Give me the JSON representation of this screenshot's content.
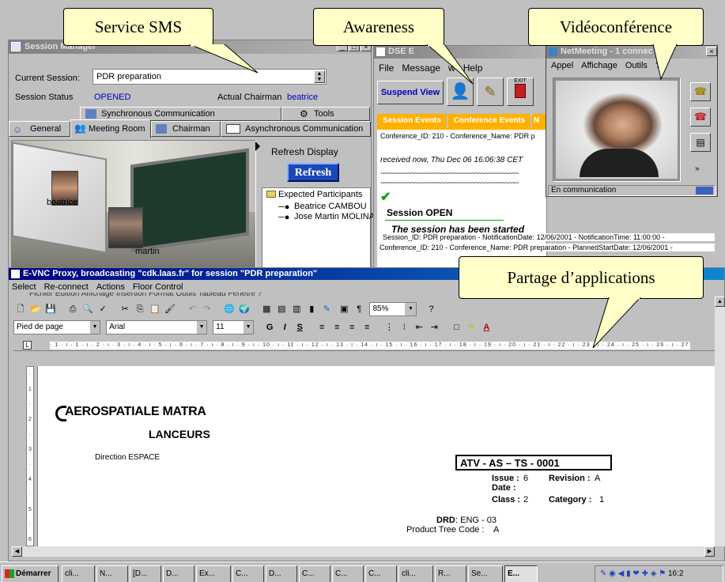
{
  "callouts": {
    "sms": "Service SMS",
    "awareness": "Awareness",
    "video": "Vidéoconférence",
    "sharing": "Partage d’applications"
  },
  "session_manager": {
    "title": "Session Manager",
    "current_session_label": "Current Session:",
    "current_session_value": "PDR preparation",
    "status_label": "Session Status",
    "status_value": "OPENED",
    "chairman_label": "Actual Chairman",
    "chairman_value": "beatrice",
    "tabs_row1": [
      "Synchronous Communication",
      "Tools"
    ],
    "tabs_row2": [
      "General",
      "Meeting Room",
      "Chairman",
      "Asynchronous Communication"
    ],
    "refresh_display_label": "Refresh Display",
    "refresh_button": "Refresh",
    "participants_header": "Expected Participants",
    "participants": [
      "Beatrice CAMBOU",
      "Jose Martin MOLINA"
    ],
    "avatars": [
      "beatrice",
      "martin"
    ]
  },
  "dse_window": {
    "title": "DSE E",
    "menu": [
      "File",
      "Message",
      "w",
      "Help"
    ],
    "suspend_view": "Suspend View",
    "exit_label": "EXIT",
    "tabs": [
      "Session Events",
      "Conference Events",
      "N"
    ],
    "lines": [
      "Conference_ID: 210 - Conference_Name: PDR p",
      "received now, Thu Dec 06 16:06:38 CET",
      "~~~~~~~~~~~~~~~~~~~~~~~~~~~~~~~~~~~~~~~~~",
      "~~~~~~~~~~~~~~~~~~~~~~~~~~~~~~~~~~~~~~~~~"
    ],
    "event_title": "Session OPEN",
    "event_subtitle": "The session has been started",
    "event_detail1": "Session_ID: PDR preparation - NotificationDate: 12/06/2001 - NotificationTime: 11:00:00 -",
    "event_detail2": "Conference_ID: 210 - Conference_Name: PDR preparation - PlannedStartDate: 12/06/2001 -"
  },
  "netmeeting": {
    "title": "NetMeeting - 1 connec",
    "menu": [
      "Appel",
      "Affichage",
      "Outils",
      "?"
    ],
    "status": "En communication"
  },
  "vnc": {
    "title": "E-VNC Proxy, broadcasting \"cdk.laas.fr\" for session \"PDR preparation\"",
    "menu": [
      "Select",
      "Re-connect",
      "Actions",
      "Floor Control"
    ],
    "word_menu_partial": "Fichier  Edition  Affichage  Insertion  Format  Outils  Tableau  Fenêtre  ?",
    "zoom": "85%",
    "style_value": "Pied de page",
    "font_value": "Arial",
    "size_value": "11"
  },
  "document": {
    "logo_line1": "AEROSPATIALE MATRA",
    "logo_line2": "LANCEURS",
    "direction": "Direction ESPACE",
    "ref": "ATV - AS – TS - 0001",
    "issue_label": "Issue :",
    "issue_value": "6",
    "revision_label": "Revision :",
    "revision_value": "A",
    "date_label": "Date :",
    "class_label": "Class :",
    "class_value": "2",
    "category_label": "Category :",
    "category_value": "1",
    "drd_label": "DRD",
    "drd_value": ": ENG - 03",
    "ptc_label": "Product Tree Code :",
    "ptc_value": "A"
  },
  "taskbar": {
    "start": "Démarrer",
    "items": [
      "cli...",
      "N...",
      "[D...",
      "D...",
      "Ex...",
      "C...",
      "D...",
      "C...",
      "C...",
      "C...",
      "cli...",
      "R...",
      "Se...",
      "E..."
    ],
    "clock": "16:2"
  }
}
